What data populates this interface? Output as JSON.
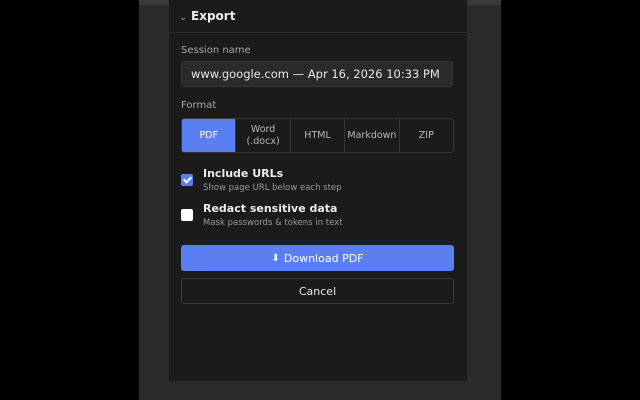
{
  "colors": {
    "accent": "#5a7ff0",
    "panel_bg": "#1b1b1b",
    "backdrop": "#2b2b2b"
  },
  "header": {
    "back_icon": "back-chevron-icon",
    "title": "Export"
  },
  "session": {
    "label": "Session name",
    "value": "www.google.com — Apr 16, 2026 10:33 PM"
  },
  "format": {
    "label": "Format",
    "selected": "PDF",
    "options": [
      {
        "label": "PDF"
      },
      {
        "label": "Word\n(.docx)"
      },
      {
        "label": "HTML"
      },
      {
        "label": "Markdown"
      },
      {
        "label": "ZIP"
      }
    ]
  },
  "options": {
    "include_urls": {
      "title": "Include URLs",
      "subtitle": "Show page URL below each step",
      "checked": true
    },
    "redact": {
      "title": "Redact sensitive data",
      "subtitle": "Mask passwords & tokens in text",
      "checked": false
    }
  },
  "actions": {
    "download_icon": "download-icon",
    "download_label": "Download PDF",
    "cancel_label": "Cancel"
  }
}
